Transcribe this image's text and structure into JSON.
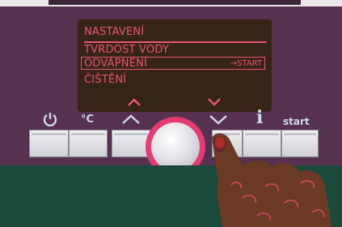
{
  "display": {
    "menu_items": [
      "Nastavení",
      "Tvrdost vody",
      "Odvápnění",
      "Čištění"
    ],
    "selected_index": 2,
    "selected_hint": "→START"
  },
  "controls": {
    "power_icon": "power-icon",
    "temp_label": "°C",
    "up_arrow": "chevron-up-icon",
    "down_arrow": "chevron-down-icon",
    "info_label": "i",
    "start_label": "start",
    "display_arrow_up": "^",
    "display_arrow_down": "v"
  },
  "colors": {
    "panel": "#573150",
    "display_bg": "#362516",
    "display_text": "#e9527a",
    "knob_ring": "#e43b72",
    "label_text": "#cfd8e8",
    "lower_panel": "#1a4a3c"
  }
}
